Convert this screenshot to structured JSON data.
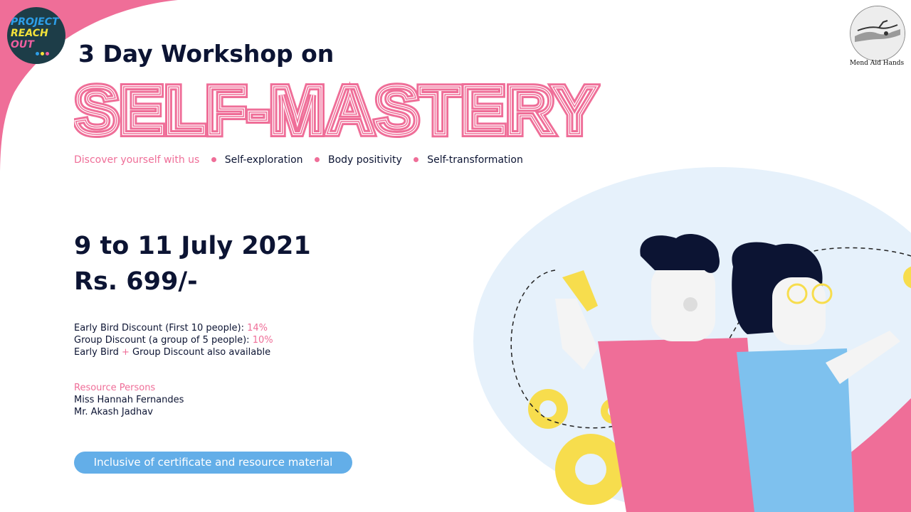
{
  "colors": {
    "pink": "#ef6e98",
    "navy": "#0c1433",
    "blue_pill": "#63aee8",
    "light_blue_bg": "#e6f1fb",
    "yellow": "#f7dd4d"
  },
  "logo_left": {
    "line1": "PROJECT",
    "line2": "REACH",
    "line3": "OUT"
  },
  "logo_right": {
    "icon": "hands-icon",
    "caption": "Mend Aid Hands"
  },
  "header": {
    "subtitle": "3 Day Workshop on",
    "title": "SELF-MASTERY"
  },
  "tagline": {
    "lead": "Discover yourself with us",
    "items": [
      "Self-exploration",
      "Body positivity",
      "Self-transformation"
    ]
  },
  "event": {
    "dates": "9 to 11 July 2021",
    "price": "Rs. 699/-"
  },
  "discounts": {
    "early_bird_label": "Early Bird Discount (First 10 people): ",
    "early_bird_value": "14%",
    "group_label": "Group Discount (a group of 5 people): ",
    "group_value": "10%",
    "combo_a": "Early Bird ",
    "combo_plus": "+",
    "combo_b": " Group Discount also available"
  },
  "resources": {
    "heading": "Resource Persons",
    "persons": [
      "Miss Hannah Fernandes",
      "Mr. Akash Jadhav"
    ]
  },
  "pill_text": "Inclusive of certificate and resource material"
}
